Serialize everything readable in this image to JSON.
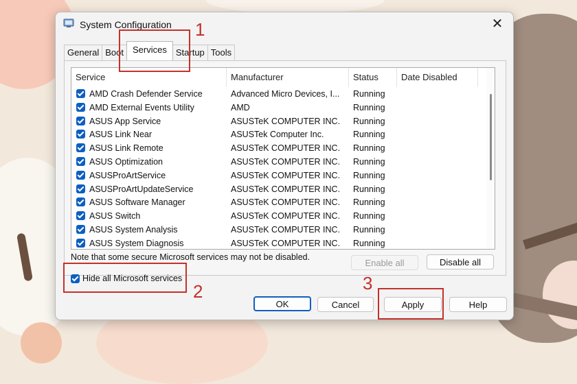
{
  "window": {
    "title": "System Configuration",
    "close_glyph": "✕"
  },
  "tabs": [
    {
      "label": "General"
    },
    {
      "label": "Boot"
    },
    {
      "label": "Services",
      "active": true
    },
    {
      "label": "Startup"
    },
    {
      "label": "Tools"
    }
  ],
  "services_table": {
    "columns": [
      "Service",
      "Manufacturer",
      "Status",
      "Date Disabled"
    ],
    "rows": [
      {
        "service": "AMD Crash Defender Service",
        "manufacturer": "Advanced Micro Devices, I...",
        "status": "Running",
        "date_disabled": "",
        "checked": true
      },
      {
        "service": "AMD External Events Utility",
        "manufacturer": "AMD",
        "status": "Running",
        "date_disabled": "",
        "checked": true
      },
      {
        "service": "ASUS App Service",
        "manufacturer": "ASUSTeK COMPUTER INC.",
        "status": "Running",
        "date_disabled": "",
        "checked": true
      },
      {
        "service": "ASUS Link Near",
        "manufacturer": "ASUSTek Computer Inc.",
        "status": "Running",
        "date_disabled": "",
        "checked": true
      },
      {
        "service": "ASUS Link Remote",
        "manufacturer": "ASUSTeK COMPUTER INC.",
        "status": "Running",
        "date_disabled": "",
        "checked": true
      },
      {
        "service": "ASUS Optimization",
        "manufacturer": "ASUSTeK COMPUTER INC.",
        "status": "Running",
        "date_disabled": "",
        "checked": true
      },
      {
        "service": "ASUSProArtService",
        "manufacturer": "ASUSTeK COMPUTER INC.",
        "status": "Running",
        "date_disabled": "",
        "checked": true
      },
      {
        "service": "ASUSProArtUpdateService",
        "manufacturer": "ASUSTeK COMPUTER INC.",
        "status": "Running",
        "date_disabled": "",
        "checked": true
      },
      {
        "service": "ASUS Software Manager",
        "manufacturer": "ASUSTeK COMPUTER INC.",
        "status": "Running",
        "date_disabled": "",
        "checked": true
      },
      {
        "service": "ASUS Switch",
        "manufacturer": "ASUSTeK COMPUTER INC.",
        "status": "Running",
        "date_disabled": "",
        "checked": true
      },
      {
        "service": "ASUS System Analysis",
        "manufacturer": "ASUSTeK COMPUTER INC.",
        "status": "Running",
        "date_disabled": "",
        "checked": true
      },
      {
        "service": "ASUS System Diagnosis",
        "manufacturer": "ASUSTeK COMPUTER INC.",
        "status": "Running",
        "date_disabled": "",
        "checked": true
      }
    ]
  },
  "note": "Note that some secure Microsoft services may not be disabled.",
  "buttons": {
    "enable_all": "Enable all",
    "disable_all": "Disable all",
    "ok": "OK",
    "cancel": "Cancel",
    "apply": "Apply",
    "help": "Help"
  },
  "hide_microsoft": {
    "label": "Hide all Microsoft services",
    "checked": true
  },
  "annotations": [
    "1",
    "2",
    "3"
  ],
  "colors": {
    "accent": "#0d5fc1",
    "annotation": "#c4302b"
  }
}
